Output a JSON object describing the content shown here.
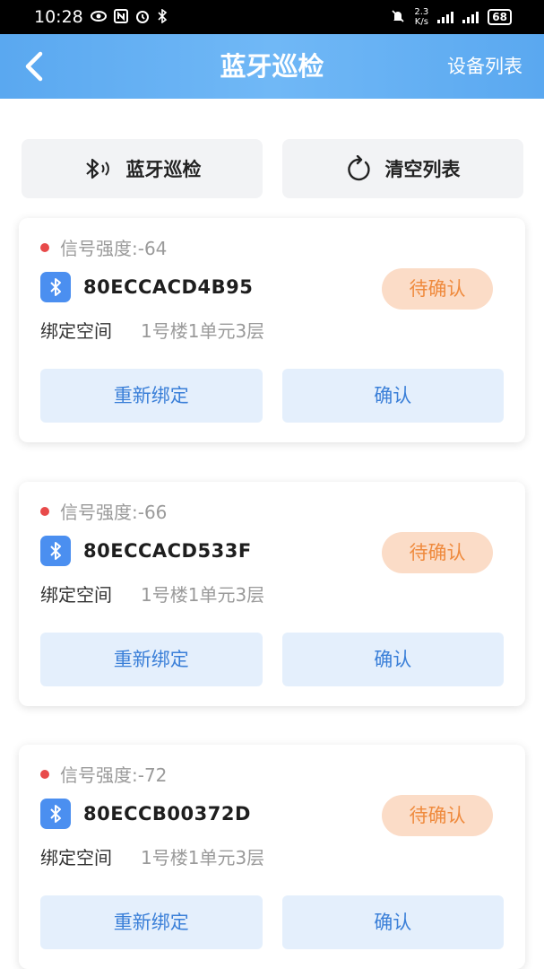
{
  "status_bar": {
    "time": "10:28",
    "speed_value": "2.3",
    "speed_unit": "K/s",
    "battery": "68",
    "net1": "4G",
    "net2": "4G"
  },
  "header": {
    "title": "蓝牙巡检",
    "action_label": "设备列表",
    "bg_color": "#5aa8f0"
  },
  "toolbar": {
    "scan_label": "蓝牙巡检",
    "clear_label": "清空列表"
  },
  "devices": [
    {
      "signal": "信号强度:-64",
      "device_id": "80ECCACD4B95",
      "status": "待确认",
      "space_label": "绑定空间",
      "space_value": "1号楼1单元3层",
      "rebind_label": "重新绑定",
      "confirm_label": "确认"
    },
    {
      "signal": "信号强度:-66",
      "device_id": "80ECCACD533F",
      "status": "待确认",
      "space_label": "绑定空间",
      "space_value": "1号楼1单元3层",
      "rebind_label": "重新绑定",
      "confirm_label": "确认"
    },
    {
      "signal": "信号强度:-72",
      "device_id": "80ECCB00372D",
      "status": "待确认",
      "space_label": "绑定空间",
      "space_value": "1号楼1单元3层",
      "rebind_label": "重新绑定",
      "confirm_label": "确认"
    }
  ],
  "colors": {
    "accent": "#4b8ff0",
    "pending_bg": "#fbdcc7",
    "pending_text": "#ef8a3d",
    "signal_dot": "#e84a4a"
  }
}
